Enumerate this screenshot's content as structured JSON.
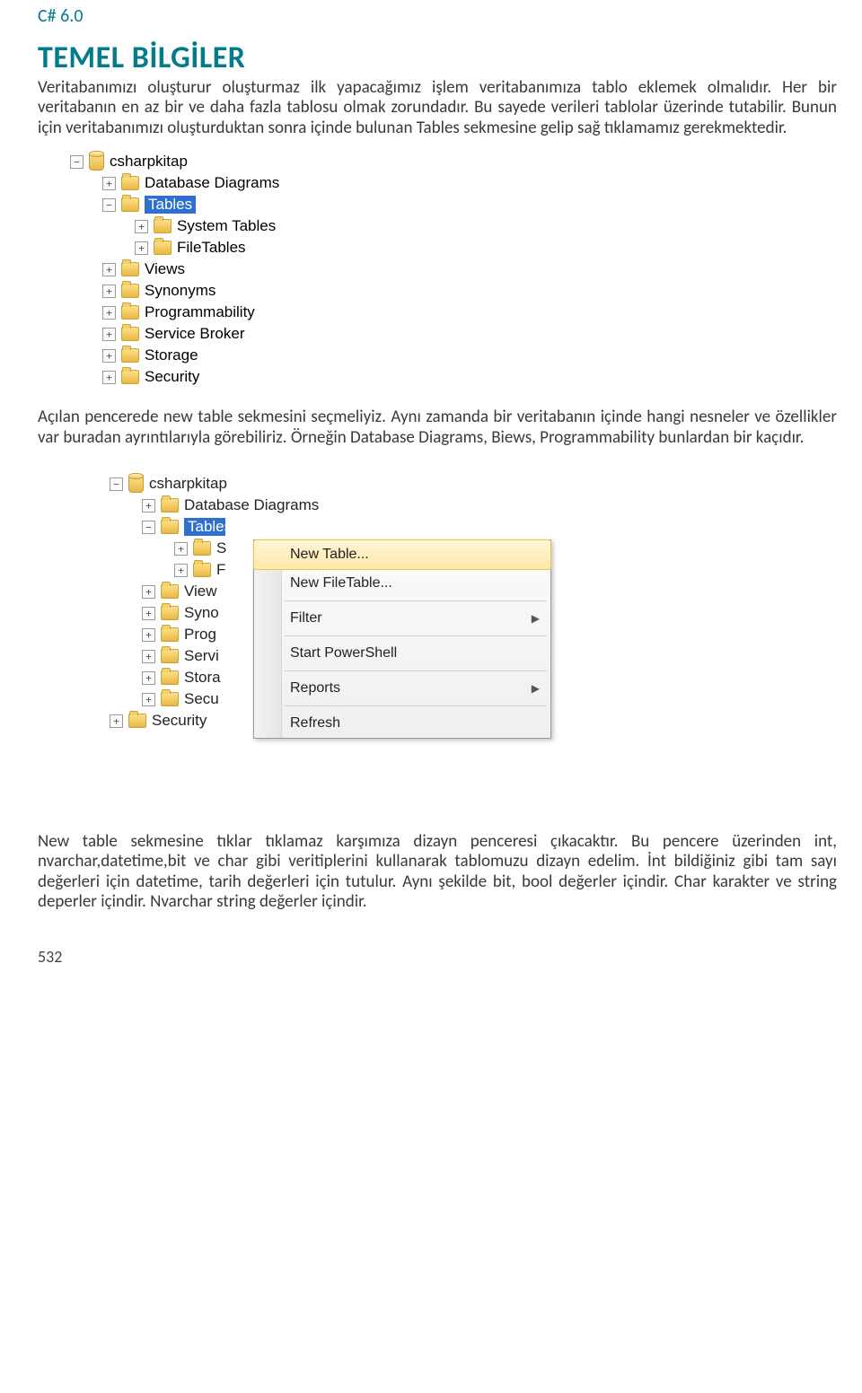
{
  "book_header": "C# 6.0",
  "section_title": "TEMEL BİLGİLER",
  "para1": "Veritabanımızı oluşturur oluşturmaz ilk yapacağımız işlem veritabanımıza tablo eklemek olmalıdır. Her bir veritabanın en az bir ve daha fazla tablosu olmak zorundadır. Bu sayede verileri tablolar üzerinde tutabilir. Bunun için veritabanımızı oluşturduktan sonra içinde bulunan Tables sekmesine gelip sağ tıklamamız gerekmektedir.",
  "para2": "Açılan pencerede new table sekmesini seçmeliyiz. Aynı zamanda bir veritabanın içinde hangi nesneler ve özellikler var buradan ayrıntılarıyla görebiliriz. Örneğin Database Diagrams, Biews, Programmability bunlardan bir kaçıdır.",
  "para3": "New table sekmesine tıklar tıklamaz karşımıza dizayn penceresi çıkacaktır. Bu pencere üzerinden int, nvarchar,datetime,bit ve char gibi veritiplerini kullanarak tablomuzu dizayn edelim. İnt bildiğiniz gibi tam sayı değerleri için datetime, tarih değerleri için tutulur. Aynı şekilde bit, bool değerler içindir. Char karakter ve string deperler içindir. Nvarchar string değerler içindir.",
  "page_number": "532",
  "tree1": {
    "root": "csharpkitap",
    "items_l1": [
      "Database Diagrams",
      "Tables",
      "Views",
      "Synonyms",
      "Programmability",
      "Service Broker",
      "Storage",
      "Security"
    ],
    "items_l2_under_tables": [
      "System Tables",
      "FileTables"
    ],
    "selected": "Tables"
  },
  "tree2": {
    "root": "csharpkitap",
    "l1_first": "Database Diagrams",
    "l1_tables": "Tables",
    "l2_trunc": [
      "S",
      "F"
    ],
    "l1_trunc": [
      "View",
      "Syno",
      "Prog",
      "Servi",
      "Stora",
      "Secu"
    ],
    "l0_extra": "Security"
  },
  "context_menu": {
    "items": [
      {
        "label": "New Table...",
        "arrow": false,
        "hl": true
      },
      {
        "label": "New FileTable...",
        "arrow": false,
        "hl": false
      },
      {
        "sep": true
      },
      {
        "label": "Filter",
        "arrow": true,
        "hl": false
      },
      {
        "sep": true
      },
      {
        "label": "Start PowerShell",
        "arrow": false,
        "hl": false
      },
      {
        "sep": true
      },
      {
        "label": "Reports",
        "arrow": true,
        "hl": false
      },
      {
        "sep": true
      },
      {
        "label": "Refresh",
        "arrow": false,
        "hl": false
      }
    ]
  }
}
